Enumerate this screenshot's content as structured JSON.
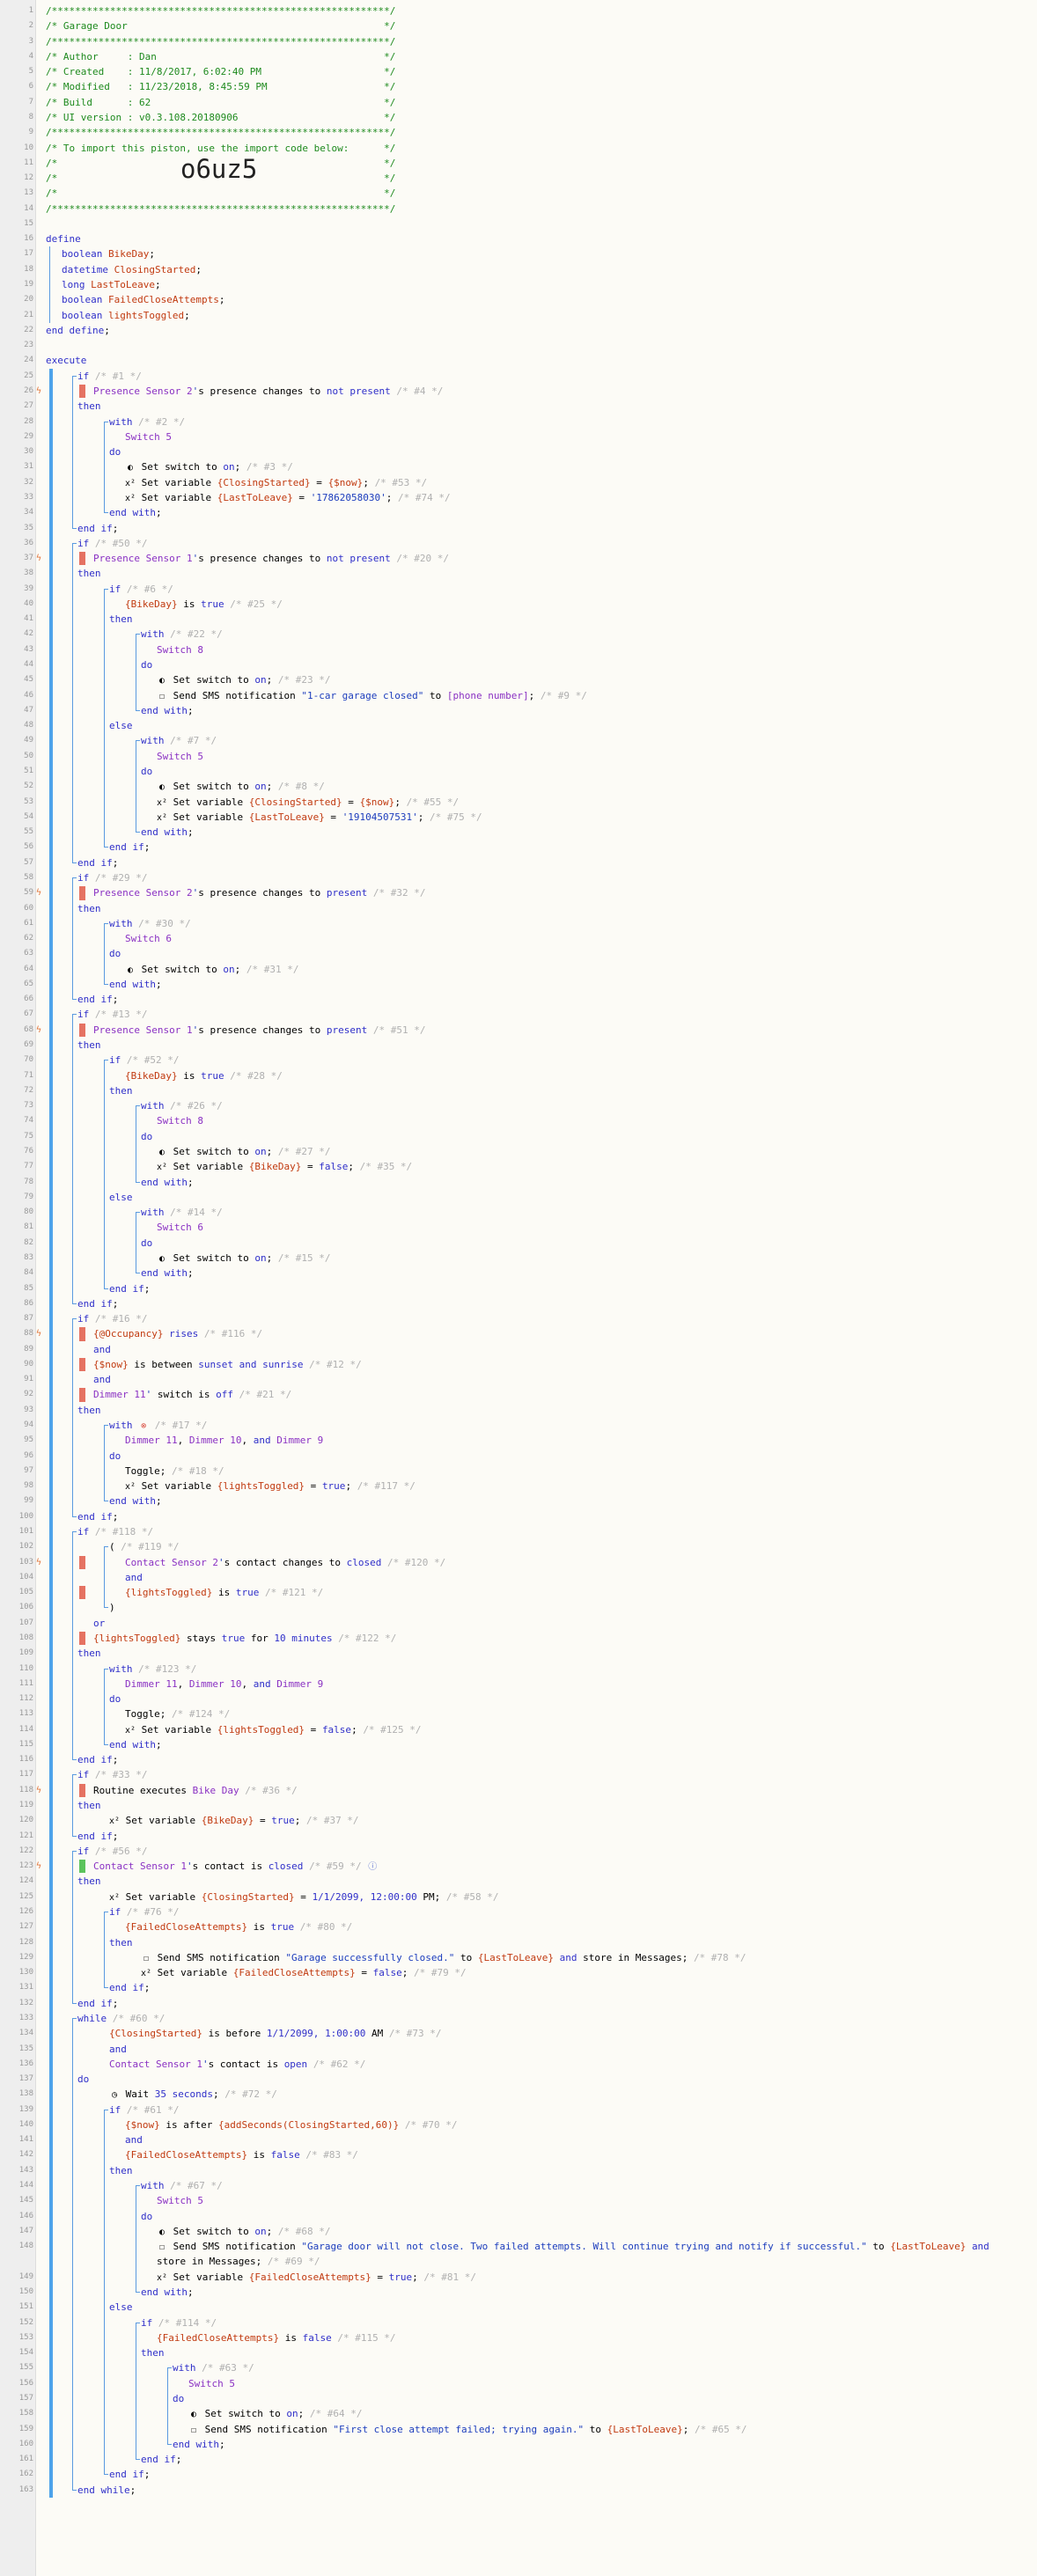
{
  "import_code": "o6uz5",
  "colors": {
    "keyword": "#2f2fc9",
    "comment": "#b0b0b0",
    "header_comment": "#1e8a1e",
    "device": "#8a31c3",
    "variable": "#c13a10",
    "rail_blue": "#4ea3ea",
    "condition_false_flag": "#e57262",
    "condition_true_flag": "#5cc45c",
    "breakpoint_icon": "#e0743a",
    "background": "#fcfbf6"
  },
  "icon_names": {
    "toggle": "switch-toggle-icon",
    "variable": "variable-x2-icon",
    "message": "message-bubble-icon",
    "timer": "timer-clock-icon",
    "breakpoint": "lightning-bolt-icon",
    "cancel": "cancel-circle-icon",
    "info": "info-circle-icon"
  },
  "lines": [
    [
      1,
      0,
      "",
      0,
      "/**********************************************************/",
      "hdr"
    ],
    [
      2,
      0,
      "",
      0,
      "/* Garage Door                                            */",
      "hdr"
    ],
    [
      3,
      0,
      "",
      0,
      "/**********************************************************/",
      "hdr"
    ],
    [
      4,
      0,
      "",
      0,
      "/* Author     : Dan                                       */",
      "hdr"
    ],
    [
      5,
      0,
      "",
      0,
      "/* Created    : 11/8/2017, 6:02:40 PM                     */",
      "hdr"
    ],
    [
      6,
      0,
      "",
      0,
      "/* Modified   : 11/23/2018, 8:45:59 PM                    */",
      "hdr"
    ],
    [
      7,
      0,
      "",
      0,
      "/* Build      : 62                                        */",
      "hdr"
    ],
    [
      8,
      0,
      "",
      0,
      "/* UI version : v0.3.108.20180906                         */",
      "hdr"
    ],
    [
      9,
      0,
      "",
      0,
      "/**********************************************************/",
      "hdr"
    ],
    [
      10,
      0,
      "",
      0,
      "/* To import this piston, use the import code below:      */",
      "hdr"
    ],
    [
      11,
      0,
      "",
      0,
      "/*                                                        */",
      "hdr"
    ],
    [
      12,
      0,
      "",
      0,
      "/*                                                        */",
      "hdr"
    ],
    [
      13,
      0,
      "",
      0,
      "/*                                                        */",
      "hdr"
    ],
    [
      14,
      0,
      "",
      0,
      "/**********************************************************/",
      "hdr"
    ],
    [
      15,
      0,
      "",
      0,
      "",
      ""
    ],
    [
      16,
      0,
      "",
      0,
      "define",
      "kw"
    ],
    [
      17,
      0,
      "",
      1,
      "boolean BikeDay;",
      "def"
    ],
    [
      18,
      0,
      "",
      1,
      "datetime ClosingStarted;",
      "def"
    ],
    [
      19,
      0,
      "",
      1,
      "long LastToLeave;",
      "def"
    ],
    [
      20,
      0,
      "",
      1,
      "boolean FailedCloseAttempts;",
      "def"
    ],
    [
      21,
      0,
      "",
      1,
      "boolean lightsToggled;",
      "def"
    ],
    [
      22,
      0,
      "",
      0,
      "end define;",
      "kw"
    ],
    [
      23,
      0,
      "",
      0,
      "",
      ""
    ],
    [
      24,
      0,
      "",
      0,
      "execute",
      "kw"
    ],
    [
      25,
      0,
      "",
      2,
      "if /* #1 */",
      "ifc"
    ],
    [
      26,
      1,
      "",
      3,
      "Presence Sensor 2's presence changes to not present /* #4 */",
      "cond"
    ],
    [
      27,
      0,
      "",
      2,
      "then",
      "kw"
    ],
    [
      28,
      0,
      "",
      4,
      "with /* #2 */",
      "withc"
    ],
    [
      29,
      0,
      "",
      5,
      "Switch 5",
      "dev"
    ],
    [
      30,
      0,
      "",
      4,
      "do",
      "kw"
    ],
    [
      31,
      0,
      "",
      5,
      "Set switch to on; /* #3 */",
      "act:toggle"
    ],
    [
      32,
      0,
      "",
      5,
      "Set variable {ClosingStarted} = {$now}; /* #53 */",
      "act:variable"
    ],
    [
      33,
      0,
      "",
      5,
      "Set variable {LastToLeave} = '17862058030'; /* #74 */",
      "act:variable"
    ],
    [
      34,
      0,
      "",
      4,
      "end with;",
      "kw"
    ],
    [
      35,
      0,
      "",
      2,
      "end if;",
      "kw"
    ],
    [
      36,
      0,
      "",
      2,
      "if /* #50 */",
      "ifc"
    ],
    [
      37,
      1,
      "",
      3,
      "Presence Sensor 1's presence changes to not present /* #20 */",
      "cond"
    ],
    [
      38,
      0,
      "",
      2,
      "then",
      "kw"
    ],
    [
      39,
      0,
      "",
      4,
      "if /* #6 */",
      "ifc"
    ],
    [
      40,
      0,
      "",
      5,
      "{BikeDay} is true /* #25 */",
      "cond"
    ],
    [
      41,
      0,
      "",
      4,
      "then",
      "kw"
    ],
    [
      42,
      0,
      "",
      6,
      "with /* #22 */",
      "withc"
    ],
    [
      43,
      0,
      "",
      7,
      "Switch 8",
      "dev"
    ],
    [
      44,
      0,
      "",
      6,
      "do",
      "kw"
    ],
    [
      45,
      0,
      "",
      7,
      "Set switch to on; /* #23 */",
      "act:toggle"
    ],
    [
      46,
      0,
      "",
      7,
      "Send SMS notification \"1-car garage closed\" to [phone number]; /* #9 */",
      "act:message"
    ],
    [
      47,
      0,
      "",
      6,
      "end with;",
      "kw"
    ],
    [
      48,
      0,
      "",
      4,
      "else",
      "kw"
    ],
    [
      49,
      0,
      "",
      6,
      "with /* #7 */",
      "withc"
    ],
    [
      50,
      0,
      "",
      7,
      "Switch 5",
      "dev"
    ],
    [
      51,
      0,
      "",
      6,
      "do",
      "kw"
    ],
    [
      52,
      0,
      "",
      7,
      "Set switch to on; /* #8 */",
      "act:toggle"
    ],
    [
      53,
      0,
      "",
      7,
      "Set variable {ClosingStarted} = {$now}; /* #55 */",
      "act:variable"
    ],
    [
      54,
      0,
      "",
      7,
      "Set variable {LastToLeave} = '19104507531'; /* #75 */",
      "act:variable"
    ],
    [
      55,
      0,
      "",
      6,
      "end with;",
      "kw"
    ],
    [
      56,
      0,
      "",
      4,
      "end if;",
      "kw"
    ],
    [
      57,
      0,
      "",
      2,
      "end if;",
      "kw"
    ],
    [
      58,
      0,
      "",
      2,
      "if /* #29 */",
      "ifc"
    ],
    [
      59,
      1,
      "",
      3,
      "Presence Sensor 2's presence changes to present /* #32 */",
      "cond"
    ],
    [
      60,
      0,
      "",
      2,
      "then",
      "kw"
    ],
    [
      61,
      0,
      "",
      4,
      "with /* #30 */",
      "withc"
    ],
    [
      62,
      0,
      "",
      5,
      "Switch 6",
      "dev"
    ],
    [
      63,
      0,
      "",
      4,
      "do",
      "kw"
    ],
    [
      64,
      0,
      "",
      5,
      "Set switch to on; /* #31 */",
      "act:toggle"
    ],
    [
      65,
      0,
      "",
      4,
      "end with;",
      "kw"
    ],
    [
      66,
      0,
      "",
      2,
      "end if;",
      "kw"
    ],
    [
      67,
      0,
      "",
      2,
      "if /* #13 */",
      "ifc"
    ],
    [
      68,
      1,
      "",
      3,
      "Presence Sensor 1's presence changes to present /* #51 */",
      "cond"
    ],
    [
      69,
      0,
      "",
      2,
      "then",
      "kw"
    ],
    [
      70,
      0,
      "",
      4,
      "if /* #52 */",
      "ifc"
    ],
    [
      71,
      0,
      "",
      5,
      "{BikeDay} is true /* #28 */",
      "cond"
    ],
    [
      72,
      0,
      "",
      4,
      "then",
      "kw"
    ],
    [
      73,
      0,
      "",
      6,
      "with /* #26 */",
      "withc"
    ],
    [
      74,
      0,
      "",
      7,
      "Switch 8",
      "dev"
    ],
    [
      75,
      0,
      "",
      6,
      "do",
      "kw"
    ],
    [
      76,
      0,
      "",
      7,
      "Set switch to on; /* #27 */",
      "act:toggle"
    ],
    [
      77,
      0,
      "",
      7,
      "Set variable {BikeDay} = false; /* #35 */",
      "act:variable"
    ],
    [
      78,
      0,
      "",
      6,
      "end with;",
      "kw"
    ],
    [
      79,
      0,
      "",
      4,
      "else",
      "kw"
    ],
    [
      80,
      0,
      "",
      6,
      "with /* #14 */",
      "withc"
    ],
    [
      81,
      0,
      "",
      7,
      "Switch 6",
      "dev"
    ],
    [
      82,
      0,
      "",
      6,
      "do",
      "kw"
    ],
    [
      83,
      0,
      "",
      7,
      "Set switch to on; /* #15 */",
      "act:toggle"
    ],
    [
      84,
      0,
      "",
      6,
      "end with;",
      "kw"
    ],
    [
      85,
      0,
      "",
      4,
      "end if;",
      "kw"
    ],
    [
      86,
      0,
      "",
      2,
      "end if;",
      "kw"
    ],
    [
      87,
      0,
      "",
      2,
      "if /* #16 */",
      "ifc"
    ],
    [
      88,
      1,
      "",
      3,
      "{@Occupancy} rises /* #116 */",
      "cond"
    ],
    [
      89,
      0,
      "",
      3,
      "and",
      "kw"
    ],
    [
      90,
      0,
      "",
      3,
      "{$now} is between sunset and sunrise /* #12 */",
      "cond"
    ],
    [
      91,
      0,
      "",
      3,
      "and",
      "kw"
    ],
    [
      92,
      0,
      "",
      3,
      "Dimmer 11' switch is off /* #21 */",
      "cond"
    ],
    [
      93,
      0,
      "",
      2,
      "then",
      "kw"
    ],
    [
      94,
      0,
      "",
      4,
      "with /* #17 */",
      "withx"
    ],
    [
      95,
      0,
      "",
      5,
      "Dimmer 11, Dimmer 10, and Dimmer 9",
      "dev"
    ],
    [
      96,
      0,
      "",
      4,
      "do",
      "kw"
    ],
    [
      97,
      0,
      "",
      5,
      "Toggle; /* #18 */",
      "act"
    ],
    [
      98,
      0,
      "",
      5,
      "Set variable {lightsToggled} = true; /* #117 */",
      "act:variable"
    ],
    [
      99,
      0,
      "",
      4,
      "end with;",
      "kw"
    ],
    [
      100,
      0,
      "",
      2,
      "end if;",
      "kw"
    ],
    [
      101,
      0,
      "",
      2,
      "if /* #118 */",
      "ifc"
    ],
    [
      102,
      0,
      "",
      4,
      "( /* #119 */",
      "ifc"
    ],
    [
      103,
      1,
      "",
      5,
      "Contact Sensor 2's contact changes to closed /* #120 */",
      "cond"
    ],
    [
      104,
      0,
      "",
      5,
      "and",
      "kw"
    ],
    [
      105,
      0,
      "",
      5,
      "{lightsToggled} is true /* #121 */",
      "cond"
    ],
    [
      106,
      0,
      "",
      4,
      ")",
      "kw"
    ],
    [
      107,
      0,
      "",
      3,
      "or",
      "kw"
    ],
    [
      108,
      0,
      "",
      3,
      "{lightsToggled} stays true for 10 minutes /* #122 */",
      "cond"
    ],
    [
      109,
      0,
      "",
      2,
      "then",
      "kw"
    ],
    [
      110,
      0,
      "",
      4,
      "with /* #123 */",
      "withc"
    ],
    [
      111,
      0,
      "",
      5,
      "Dimmer 11, Dimmer 10, and Dimmer 9",
      "dev"
    ],
    [
      112,
      0,
      "",
      4,
      "do",
      "kw"
    ],
    [
      113,
      0,
      "",
      5,
      "Toggle; /* #124 */",
      "act"
    ],
    [
      114,
      0,
      "",
      5,
      "Set variable {lightsToggled} = false; /* #125 */",
      "act:variable"
    ],
    [
      115,
      0,
      "",
      4,
      "end with;",
      "kw"
    ],
    [
      116,
      0,
      "",
      2,
      "end if;",
      "kw"
    ],
    [
      117,
      0,
      "",
      2,
      "if /* #33 */",
      "ifc"
    ],
    [
      118,
      1,
      "",
      3,
      "Routine executes Bike Day /* #36 */",
      "cond"
    ],
    [
      119,
      0,
      "",
      2,
      "then",
      "kw"
    ],
    [
      120,
      0,
      "",
      4,
      "Set variable {BikeDay} = true; /* #37 */",
      "act:variable"
    ],
    [
      121,
      0,
      "",
      2,
      "end if;",
      "kw"
    ],
    [
      122,
      0,
      "",
      2,
      "if /* #56 */",
      "ifc"
    ],
    [
      123,
      1,
      "",
      3,
      "Contact Sensor 1's contact is closed /* #59 */",
      "condi"
    ],
    [
      124,
      0,
      "",
      2,
      "then",
      "kw"
    ],
    [
      125,
      0,
      "",
      4,
      "Set variable {ClosingStarted} = 1/1/2099, 12:00:00 PM; /* #58 */",
      "act:variable"
    ],
    [
      126,
      0,
      "",
      4,
      "if /* #76 */",
      "ifc"
    ],
    [
      127,
      0,
      "",
      5,
      "{FailedCloseAttempts} is true /* #80 */",
      "cond"
    ],
    [
      128,
      0,
      "",
      4,
      "then",
      "kw"
    ],
    [
      129,
      0,
      "",
      6,
      "Send SMS notification \"Garage successfully closed.\" to {LastToLeave} and store in Messages; /* #78 */",
      "act:message"
    ],
    [
      130,
      0,
      "",
      6,
      "Set variable {FailedCloseAttempts} = false; /* #79 */",
      "act:variable"
    ],
    [
      131,
      0,
      "",
      4,
      "end if;",
      "kw"
    ],
    [
      132,
      0,
      "",
      2,
      "end if;",
      "kw"
    ],
    [
      133,
      0,
      "",
      2,
      "while /* #60 */",
      "ifc"
    ],
    [
      134,
      0,
      "",
      4,
      "{ClosingStarted} is before 1/1/2099, 1:00:00 AM /* #73 */",
      "cond"
    ],
    [
      135,
      0,
      "",
      4,
      "and",
      "kw"
    ],
    [
      136,
      0,
      "",
      4,
      "Contact Sensor 1's contact is open /* #62 */",
      "cond"
    ],
    [
      137,
      0,
      "",
      2,
      "do",
      "kw"
    ],
    [
      138,
      0,
      "",
      4,
      "Wait 35 seconds; /* #72 */",
      "act:timer"
    ],
    [
      139,
      0,
      "",
      4,
      "if /* #61 */",
      "ifc"
    ],
    [
      140,
      0,
      "",
      5,
      "{$now} is after {addSeconds(ClosingStarted,60)} /* #70 */",
      "cond"
    ],
    [
      141,
      0,
      "",
      5,
      "and",
      "kw"
    ],
    [
      142,
      0,
      "",
      5,
      "{FailedCloseAttempts} is false /* #83 */",
      "cond"
    ],
    [
      143,
      0,
      "",
      4,
      "then",
      "kw"
    ],
    [
      144,
      0,
      "",
      6,
      "with /* #67 */",
      "withc"
    ],
    [
      145,
      0,
      "",
      7,
      "Switch 5",
      "dev"
    ],
    [
      146,
      0,
      "",
      6,
      "do",
      "kw"
    ],
    [
      147,
      0,
      "",
      7,
      "Set switch to on; /* #68 */",
      "act:toggle"
    ],
    [
      148,
      0,
      "",
      7,
      "Send SMS notification \"Garage door will not close. Two failed attempts. Will continue trying and notify if successful.\" to {LastToLeave} and",
      "act:message"
    ],
    [
      0,
      0,
      "",
      7,
      "store in Messages; /* #69 */",
      "cont"
    ],
    [
      149,
      0,
      "",
      7,
      "Set variable {FailedCloseAttempts} = true; /* #81 */",
      "act:variable"
    ],
    [
      150,
      0,
      "",
      6,
      "end with;",
      "kw"
    ],
    [
      151,
      0,
      "",
      4,
      "else",
      "kw"
    ],
    [
      152,
      0,
      "",
      6,
      "if /* #114 */",
      "ifc"
    ],
    [
      153,
      0,
      "",
      7,
      "{FailedCloseAttempts} is false /* #115 */",
      "cond"
    ],
    [
      154,
      0,
      "",
      6,
      "then",
      "kw"
    ],
    [
      155,
      0,
      "",
      8,
      "with /* #63 */",
      "withc"
    ],
    [
      156,
      0,
      "",
      9,
      "Switch 5",
      "dev"
    ],
    [
      157,
      0,
      "",
      8,
      "do",
      "kw"
    ],
    [
      158,
      0,
      "",
      9,
      "Set switch to on; /* #64 */",
      "act:toggle"
    ],
    [
      159,
      0,
      "",
      9,
      "Send SMS notification \"First close attempt failed; trying again.\" to {LastToLeave}; /* #65 */",
      "act:message"
    ],
    [
      160,
      0,
      "",
      8,
      "end with;",
      "kw"
    ],
    [
      161,
      0,
      "",
      6,
      "end if;",
      "kw"
    ],
    [
      162,
      0,
      "",
      4,
      "end if;",
      "kw"
    ],
    [
      163,
      0,
      "",
      2,
      "end while;",
      "kw"
    ]
  ]
}
